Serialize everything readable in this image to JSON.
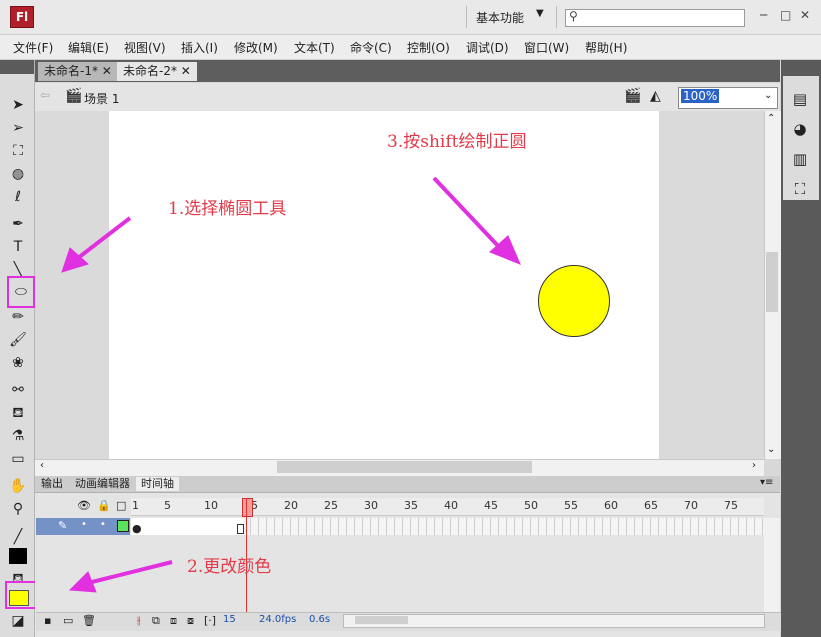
{
  "app": {
    "logo": "Fl",
    "workspace": "基本功能",
    "search_placeholder": ""
  },
  "window_controls": [
    "─",
    "□",
    "✕"
  ],
  "menu": [
    "文件(F)",
    "编辑(E)",
    "视图(V)",
    "插入(I)",
    "修改(M)",
    "文本(T)",
    "命令(C)",
    "控制(O)",
    "调试(D)",
    "窗口(W)",
    "帮助(H)"
  ],
  "tabs": [
    {
      "label": "未命名-1*",
      "close": "✕"
    },
    {
      "label": "未命名-2*",
      "close": "✕"
    }
  ],
  "editbar": {
    "back": "⇦",
    "scene": "场景 1",
    "zoom": "100%"
  },
  "timeline": {
    "tabs": [
      "输出",
      "动画编辑器",
      "时间轴"
    ],
    "frame_numbers": [
      "1",
      "5",
      "10",
      "15",
      "20",
      "25",
      "30",
      "35",
      "40",
      "45",
      "50",
      "55",
      "60",
      "65",
      "70",
      "75"
    ],
    "current_frame": 15,
    "layer_name": "",
    "bottom": {
      "frame": "15",
      "fps": "24.0fps",
      "time": "0.6s"
    }
  },
  "annotations": {
    "step1": "1.选择椭圆工具",
    "step2": "2.更改颜色",
    "step3": "3.按shift绘制正圆"
  },
  "colors": {
    "fill": "#ffff00",
    "stroke": "#000000",
    "highlight": "#e030e0",
    "annotation": "#e23a4a"
  }
}
